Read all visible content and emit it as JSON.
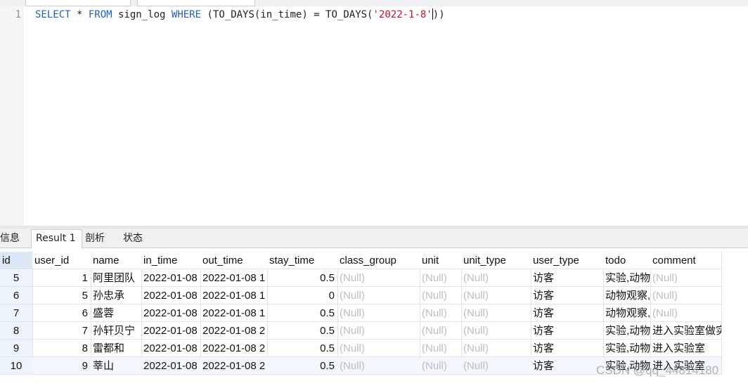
{
  "editor": {
    "line_number": "1",
    "tokens": {
      "select": "SELECT",
      "star": " * ",
      "from": "FROM",
      "table": " sign_log ",
      "where": "WHERE",
      "expr_a": " (TO_DAYS(in_time) = TO_DAYS(",
      "literal": "'2022-1-8'",
      "expr_b": "))"
    }
  },
  "tabs": [
    {
      "label": "信息"
    },
    {
      "label": "Result 1"
    },
    {
      "label": "剖析"
    },
    {
      "label": "状态"
    }
  ],
  "table": {
    "columns": [
      "id",
      "user_id",
      "name",
      "in_time",
      "out_time",
      "stay_time",
      "class_group",
      "unit",
      "unit_type",
      "user_type",
      "todo",
      "comment"
    ],
    "rows": [
      {
        "id": "5",
        "user_id": "1",
        "name": "阿里团队",
        "in_time": "2022-01-08",
        "out_time": "2022-01-08 1",
        "stay_time": "0.5",
        "class_group": "(Null)",
        "unit": "(Null)",
        "unit_type": "(Null)",
        "user_type": "访客",
        "todo": "实验,动物",
        "comment": "(Null)"
      },
      {
        "id": "6",
        "user_id": "5",
        "name": "孙忠承",
        "in_time": "2022-01-08",
        "out_time": "2022-01-08 1",
        "stay_time": "0",
        "class_group": "(Null)",
        "unit": "(Null)",
        "unit_type": "(Null)",
        "user_type": "访客",
        "todo": "动物观察,",
        "comment": "(Null)"
      },
      {
        "id": "7",
        "user_id": "6",
        "name": "盛蓉",
        "in_time": "2022-01-08",
        "out_time": "2022-01-08 1",
        "stay_time": "0.5",
        "class_group": "(Null)",
        "unit": "(Null)",
        "unit_type": "(Null)",
        "user_type": "访客",
        "todo": "动物观察,",
        "comment": "(Null)"
      },
      {
        "id": "8",
        "user_id": "7",
        "name": "孙轩贝宁",
        "in_time": "2022-01-08",
        "out_time": "2022-01-08 2",
        "stay_time": "0.5",
        "class_group": "(Null)",
        "unit": "(Null)",
        "unit_type": "(Null)",
        "user_type": "访客",
        "todo": "实验,动物",
        "comment": "进入实验室做实"
      },
      {
        "id": "9",
        "user_id": "8",
        "name": "雷都和",
        "in_time": "2022-01-08",
        "out_time": "2022-01-08 2",
        "stay_time": "0.5",
        "class_group": "(Null)",
        "unit": "(Null)",
        "unit_type": "(Null)",
        "user_type": "访客",
        "todo": "实验,动物",
        "comment": "进入实验室"
      },
      {
        "id": "10",
        "user_id": "9",
        "name": "莘山",
        "in_time": "2022-01-08",
        "out_time": "2022-01-08 2",
        "stay_time": "0.5",
        "class_group": "(Null)",
        "unit": "(Null)",
        "unit_type": "(Null)",
        "user_type": "访客",
        "todo": "实验,动物",
        "comment": "进入实验室"
      }
    ]
  },
  "watermark": "CSDN @qq_44814180",
  "colors": {
    "keyword": "#1f5fbf",
    "string": "#c8102e",
    "null_text": "#b9bec6",
    "selected_header": "#dce8f7"
  }
}
